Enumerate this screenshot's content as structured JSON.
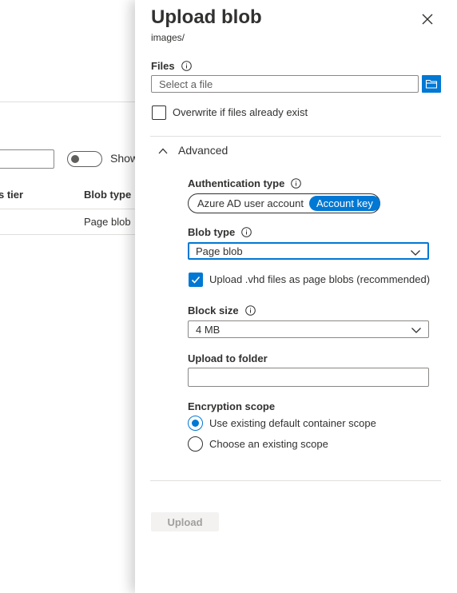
{
  "background": {
    "toggle_label": "Show",
    "columns": [
      "s tier",
      "Blob type"
    ],
    "rows": [
      {
        "blob_type": "Page blob"
      }
    ]
  },
  "blade": {
    "title": "Upload blob",
    "subtitle": "images/",
    "files": {
      "label": "Files",
      "placeholder": "Select a file"
    },
    "overwrite": {
      "label": "Overwrite if files already exist",
      "checked": false
    },
    "advanced": {
      "label": "Advanced",
      "expanded": true,
      "auth": {
        "label": "Authentication type",
        "options": [
          "Azure AD user account",
          "Account key"
        ],
        "selected": "Account key"
      },
      "blob_type": {
        "label": "Blob type",
        "value": "Page blob"
      },
      "vhd": {
        "label": "Upload .vhd files as page blobs (recommended)",
        "checked": true
      },
      "block_size": {
        "label": "Block size",
        "value": "4 MB"
      },
      "folder": {
        "label": "Upload to folder",
        "value": ""
      },
      "encryption": {
        "label": "Encryption scope",
        "options": [
          "Use existing default container scope",
          "Choose an existing scope"
        ],
        "selected": "Use existing default container scope"
      }
    },
    "upload_label": "Upload"
  },
  "colors": {
    "accent": "#0078d4",
    "text": "#323130",
    "border": "#8a8886",
    "divider": "#e1dfdd",
    "disabled_bg": "#f3f2f1",
    "disabled_text": "#a19f9d"
  },
  "icons": [
    "close-icon",
    "info-icon",
    "folder-icon",
    "chevron-up-icon",
    "chevron-down-icon",
    "checkmark-icon"
  ]
}
